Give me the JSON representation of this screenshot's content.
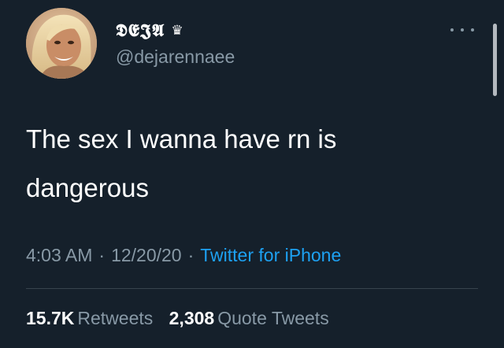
{
  "user": {
    "display_name": "𝕯𝕰𝕵𝕬",
    "crown_glyph": "♛",
    "handle": "@dejarennaee",
    "avatar": "profile-photo"
  },
  "menu": {
    "icon": "more-horizontal-icon"
  },
  "tweet": {
    "text": "The sex I wanna have rn is\ndangerous",
    "time": "4:03 AM",
    "date": "12/20/20",
    "separator": "·",
    "source": "Twitter for iPhone"
  },
  "stats": {
    "retweets_count": "15.7K",
    "retweets_label": "Retweets",
    "quotes_count": "2,308",
    "quotes_label": "Quote Tweets"
  },
  "colors": {
    "background": "#15202b",
    "text_primary": "#ffffff",
    "text_secondary": "#8899a6",
    "link": "#1da1f2",
    "divider": "#38444d"
  }
}
